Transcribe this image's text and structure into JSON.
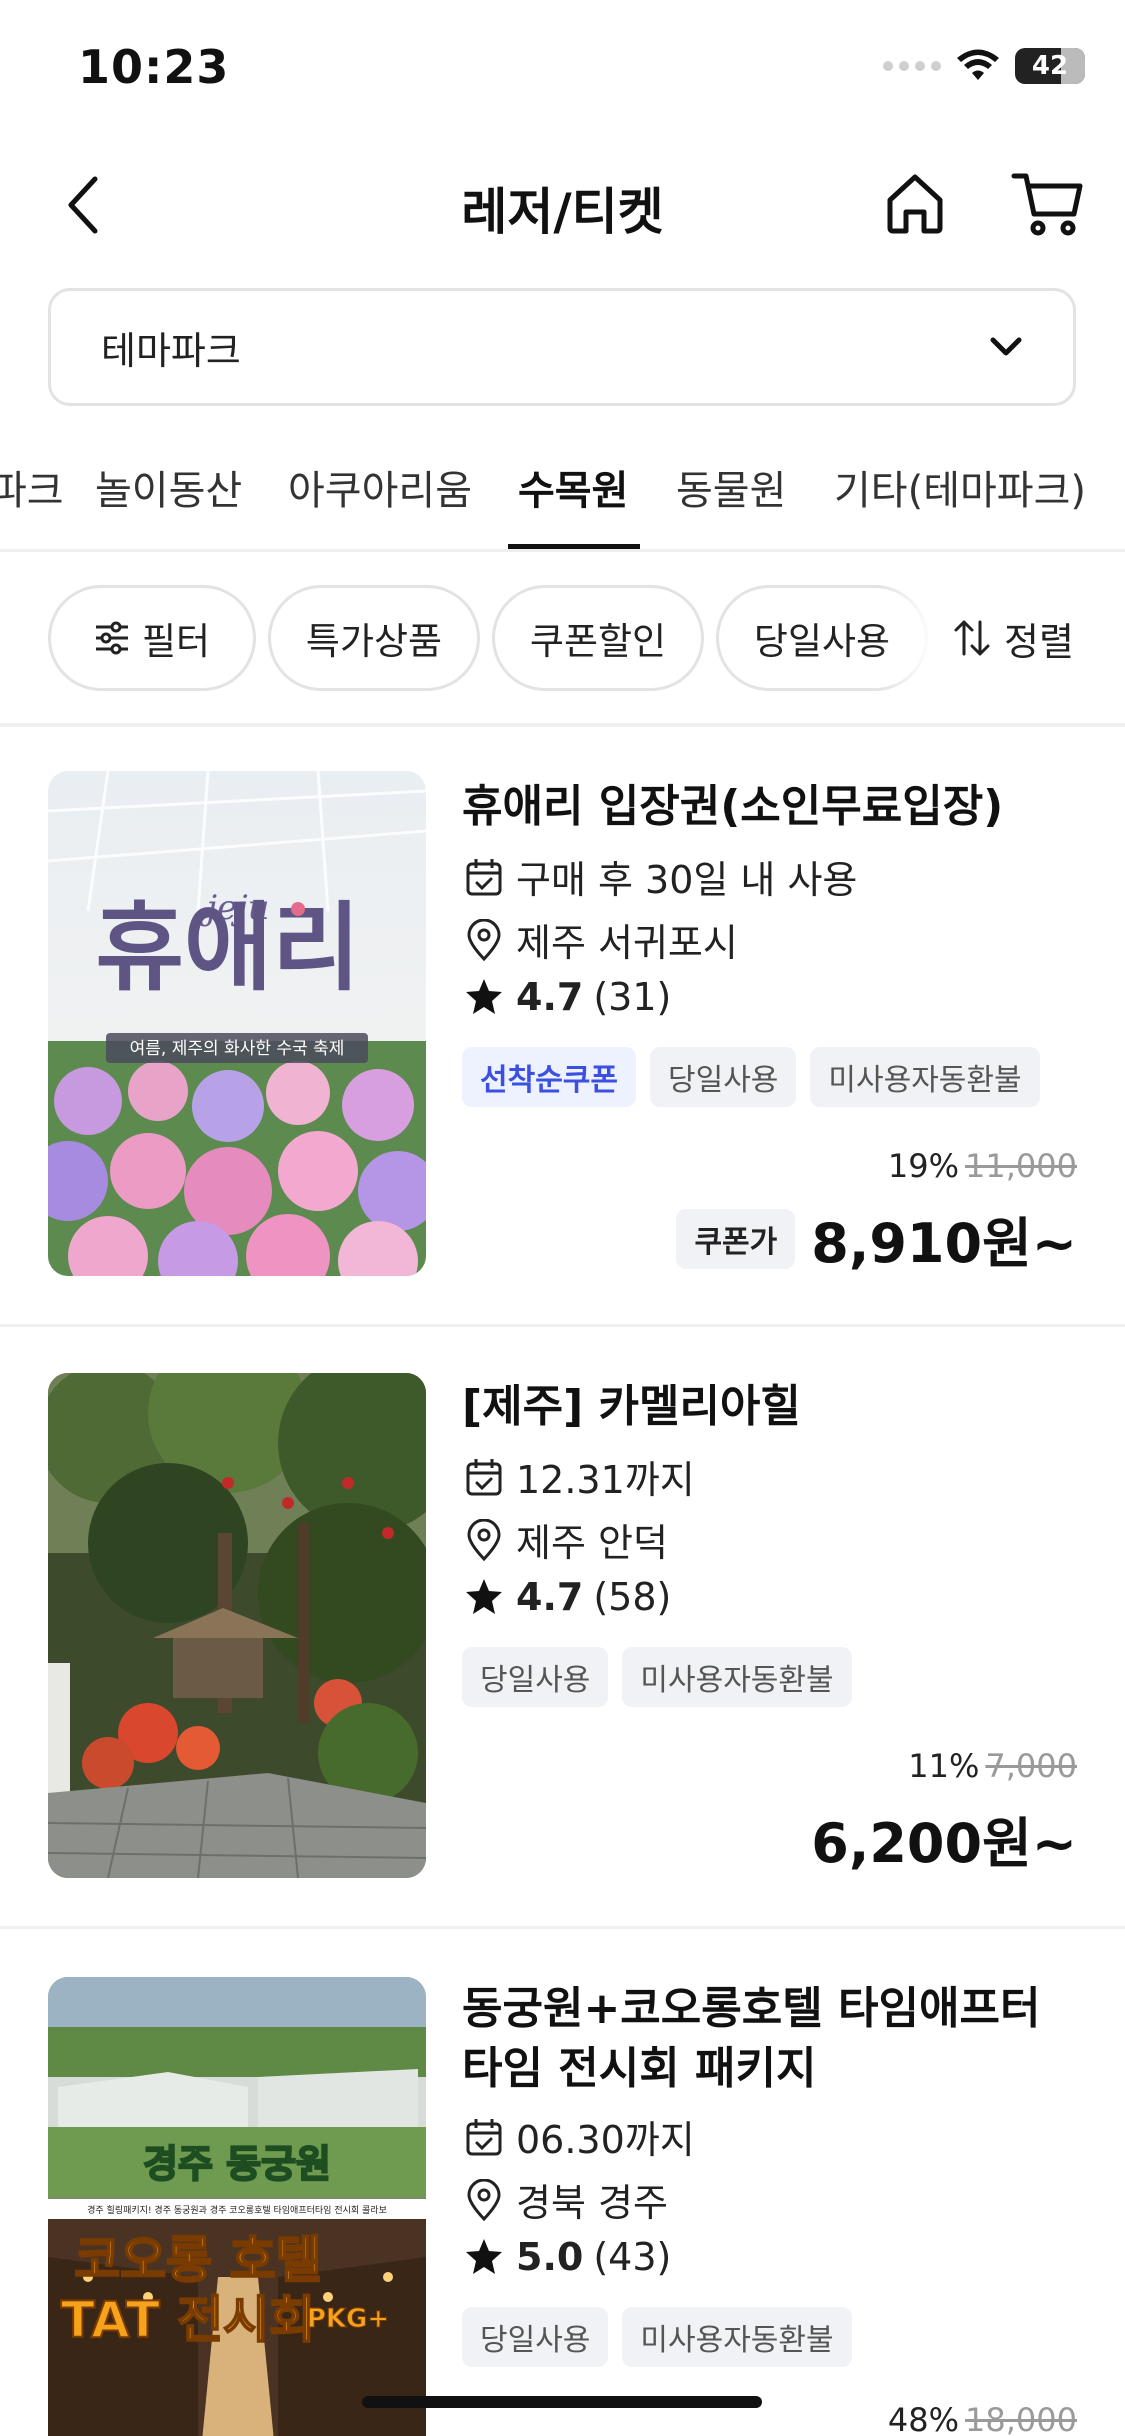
{
  "status_bar": {
    "time": "10:23",
    "battery": "42"
  },
  "header": {
    "title": "레저/티켓"
  },
  "category_select": {
    "value": "테마파크"
  },
  "tabs": [
    {
      "label": "파크"
    },
    {
      "label": "놀이동산"
    },
    {
      "label": "아쿠아리움"
    },
    {
      "label": "수목원"
    },
    {
      "label": "동물원"
    },
    {
      "label": "기타(테마파크)"
    }
  ],
  "active_tab": "수목원",
  "filters": {
    "filter_label": "필터",
    "chips": [
      {
        "label": "특가상품"
      },
      {
        "label": "쿠폰할인"
      },
      {
        "label": "당일사용"
      }
    ],
    "sort_label": "정렬"
  },
  "products": [
    {
      "title": "휴애리 입장권(소인무료입장)",
      "validity": "구매 후 30일 내 사용",
      "location": "제주 서귀포시",
      "rating": "4.7",
      "reviews": "(31)",
      "tags": [
        {
          "label": "선착순쿠폰",
          "type": "coupon"
        },
        {
          "label": "당일사용",
          "type": "normal"
        },
        {
          "label": "미사용자동환불",
          "type": "normal"
        }
      ],
      "discount": "19%",
      "original_price": "11,000",
      "price_label": "쿠폰가",
      "price": "8,910원~",
      "image": {
        "logo_small": "jeju",
        "logo_big": "휴애리",
        "caption": "여름, 제주의 화사한 수국 축제"
      }
    },
    {
      "title": "[제주] 카멜리아힐",
      "validity": "12.31까지",
      "location": "제주 안덕",
      "rating": "4.7",
      "reviews": "(58)",
      "tags": [
        {
          "label": "당일사용",
          "type": "normal"
        },
        {
          "label": "미사용자동환불",
          "type": "normal"
        }
      ],
      "discount": "11%",
      "original_price": "7,000",
      "price": "6,200원~"
    },
    {
      "title_line1": "동궁원+코오롱호텔 타임애프터",
      "title_line2": "타임 전시회 패키지",
      "validity": "06.30까지",
      "location": "경북 경주",
      "rating": "5.0",
      "reviews": "(43)",
      "tags": [
        {
          "label": "당일사용",
          "type": "normal"
        },
        {
          "label": "미사용자동환불",
          "type": "normal"
        }
      ],
      "discount": "48%",
      "original_price": "18,000",
      "image": {
        "headline": "경주 동궁원",
        "subline": "경주 힐링패키지! 경주 동궁원과 경주 코오롱호텔 타임애프터타임 전시회 콜라보",
        "big1": "코오롱 호텔",
        "big2": "TAT 전시회",
        "badge": "PKG+"
      }
    }
  ],
  "colors": {
    "accent_coupon": "#3b4fe0",
    "tag_bg": "#f1f2f5",
    "text_primary": "#111111",
    "strike": "#9a9a9a"
  }
}
